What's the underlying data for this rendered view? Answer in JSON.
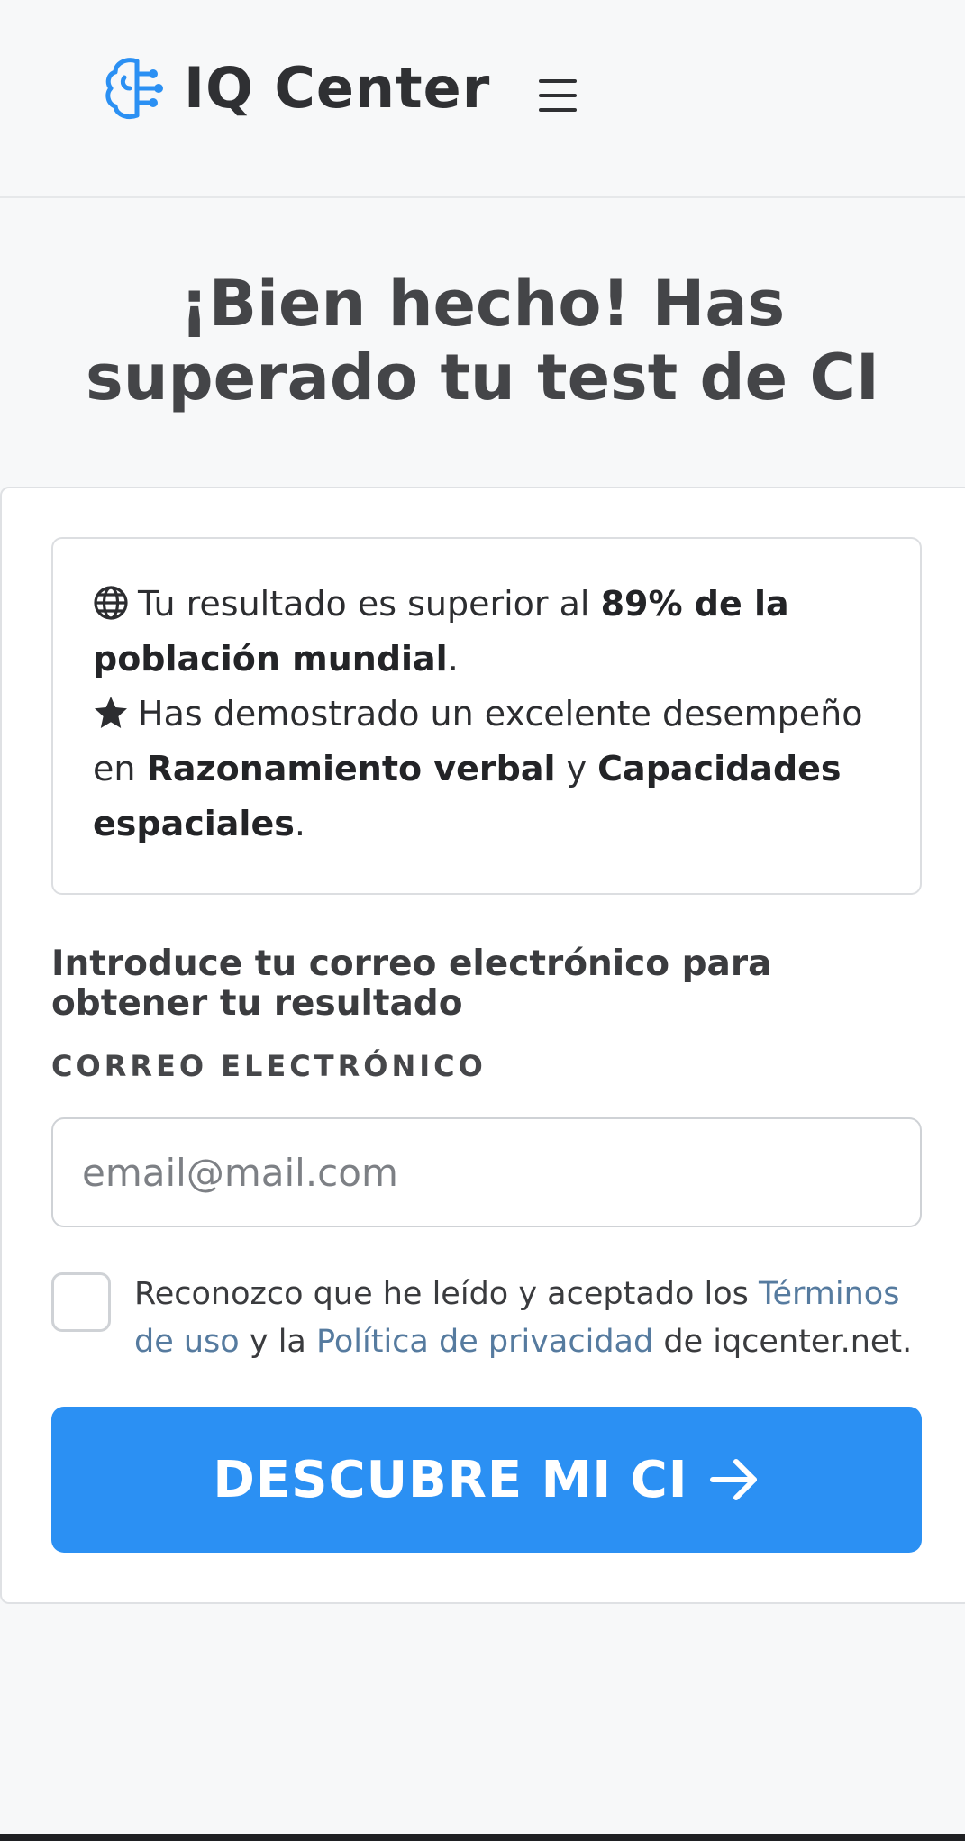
{
  "header": {
    "brand": "IQ Center",
    "logo_icon": "brain-circuit-icon",
    "menu_icon": "hamburger-menu-icon"
  },
  "title": "¡Bien hecho! Has superado tu test de CI",
  "result": {
    "line1": {
      "icon": "globe-icon",
      "text_before": "Tu resultado es superior al",
      "highlight": "89% de la población mundial",
      "text_after": "."
    },
    "line2": {
      "icon": "star-icon",
      "text_before": "Has demostrado un excelente desempeño en",
      "skill1": "Razonamiento verbal",
      "conjunction": "y",
      "skill2": "Capacidades espaciales",
      "text_after": "."
    }
  },
  "form": {
    "prompt": "Introduce tu correo electrónico para obtener tu resultado",
    "email_label": "CORREO ELECTRÓNICO",
    "email_placeholder": "email@mail.com",
    "email_value": "",
    "consent": {
      "checked": false,
      "text_before": "Reconozco que he leído y aceptado los",
      "terms_link": "Términos de uso",
      "middle": "y la",
      "privacy_link": "Política de privacidad",
      "text_after": "de iqcenter.net."
    },
    "submit_label": "DESCUBRE MI CI",
    "submit_icon": "arrow-right-icon"
  },
  "colors": {
    "accent": "#2b90f3",
    "logo": "#2b90f3",
    "link": "#567b9f",
    "text_dark": "#2f3033"
  }
}
